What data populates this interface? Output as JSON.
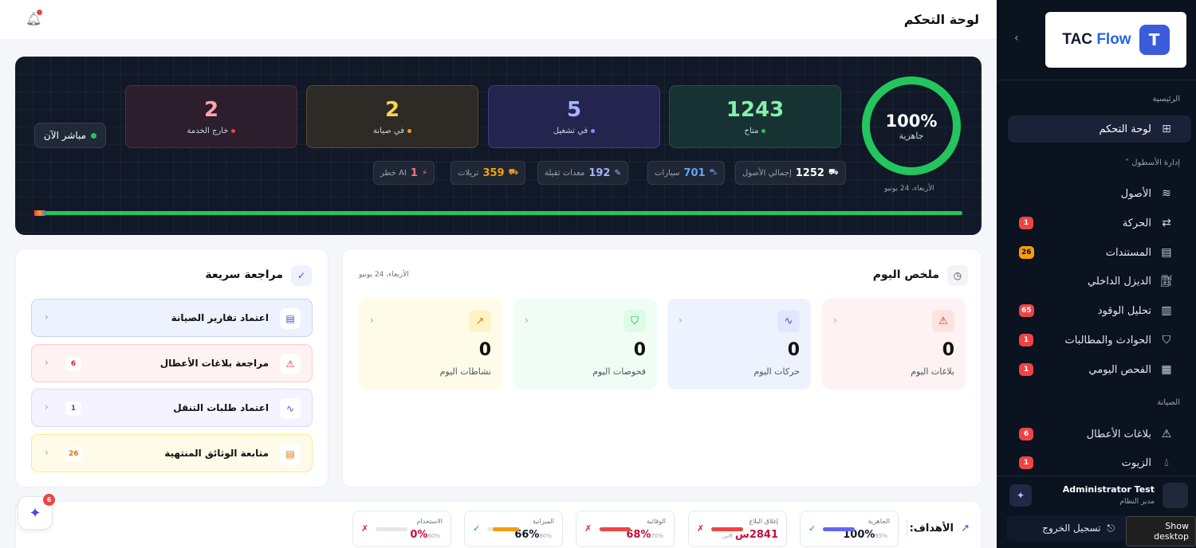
{
  "header": {
    "title": "لوحة التحكم"
  },
  "sidebar": {
    "logo": {
      "text1": "TAC ",
      "text2": "Flow",
      "mark": "T"
    },
    "sections": {
      "home": "الرئيسية",
      "fleet": "إدارة الأسطول",
      "maintenance": "الصيانة"
    },
    "items": [
      {
        "label": "لوحة التحكم",
        "icon": "grid-icon",
        "badge": ""
      },
      {
        "label": "الأصول",
        "icon": "layers-icon",
        "badge": ""
      },
      {
        "label": "الحركة",
        "icon": "transfer-icon",
        "badge": "1"
      },
      {
        "label": "المستندات",
        "icon": "document-icon",
        "badge": "26"
      },
      {
        "label": "الديزل الداخلي",
        "icon": "fuel-icon",
        "badge": ""
      },
      {
        "label": "تحليل الوقود",
        "icon": "chart-icon",
        "badge": "65"
      },
      {
        "label": "الحوادث والمطالبات",
        "icon": "shield-icon",
        "badge": "1"
      },
      {
        "label": "الفحص اليومي",
        "icon": "clipboard-icon",
        "badge": "1"
      },
      {
        "label": "بلاغات الأعطال",
        "icon": "warning-icon",
        "badge": "6"
      },
      {
        "label": "الزيوت",
        "icon": "drop-icon",
        "badge": "1"
      }
    ],
    "user": {
      "name": "Administrator Test",
      "role": "مدير النظام"
    },
    "logout": "تسجيل الخروج",
    "tooltip": "Show desktop"
  },
  "hero": {
    "readiness": {
      "value": "100%",
      "label": "جاهزية"
    },
    "date": "الأربعاء، 24 يونيو",
    "stats": [
      {
        "value": "1243",
        "label": "متاح",
        "color": "#22c55e"
      },
      {
        "value": "5",
        "label": "في تشغيل",
        "color": "#818cf8"
      },
      {
        "value": "2",
        "label": "في صيانة",
        "color": "#f59e0b"
      },
      {
        "value": "2",
        "label": "خارج الخدمة",
        "color": "#ef4444"
      }
    ],
    "live": "مباشر الآن",
    "chips": [
      {
        "value": "1252",
        "label": "إجمالي الأصول",
        "icon": "truck-icon",
        "color": "#ffffff"
      },
      {
        "value": "701",
        "label": "سيارات",
        "icon": "car-icon",
        "color": "#60a5fa"
      },
      {
        "value": "192",
        "label": "معدات ثقيلة",
        "icon": "wrench-icon",
        "color": "#a5b4fc"
      },
      {
        "value": "359",
        "label": "تريلات",
        "icon": "trailer-icon",
        "color": "#f59e0b"
      },
      {
        "value": "1",
        "label": "AI خطر",
        "icon": "bolt-icon",
        "color": "#fb7185"
      }
    ],
    "progress": 1.0
  },
  "today": {
    "title": "ملخص اليوم",
    "date": "الأربعاء، 24 يونيو",
    "tiles": [
      {
        "value": "0",
        "label": "بلاغات اليوم",
        "icon": "warning-icon"
      },
      {
        "value": "0",
        "label": "حركات اليوم",
        "icon": "activity-icon"
      },
      {
        "value": "0",
        "label": "فحوصات اليوم",
        "icon": "shield-icon"
      },
      {
        "value": "0",
        "label": "نشاطات اليوم",
        "icon": "trend-icon"
      }
    ]
  },
  "quick": {
    "title": "مراجعة سريعة",
    "items": [
      {
        "label": "اعتماد تقارير الصيانة",
        "badge": "",
        "icon": "document-icon"
      },
      {
        "label": "مراجعة بلاغات الأعطال",
        "badge": "6",
        "icon": "warning-icon"
      },
      {
        "label": "اعتماد طلبات التنقل",
        "badge": "1",
        "icon": "activity-icon"
      },
      {
        "label": "متابعة الوثائق المنتهية",
        "badge": "26",
        "icon": "file-icon"
      }
    ]
  },
  "goals": {
    "title": "الأهداف:",
    "items": [
      {
        "label": "الجاهزية",
        "value": "100%",
        "target": "85%",
        "mark": "✓",
        "fill": 1.0
      },
      {
        "label": "إغلاق البلاغ",
        "value": "2841س",
        "target": "8س",
        "mark": "✗",
        "fill": 1.0
      },
      {
        "label": "الوقائية",
        "value": "68%",
        "target": "70%",
        "mark": "✗",
        "fill": 0.97
      },
      {
        "label": "الميزانية",
        "value": "66%",
        "target": "80%",
        "mark": "✓",
        "fill": 0.82
      },
      {
        "label": "الاستخدام",
        "value": "0%",
        "target": "60%",
        "mark": "✗",
        "fill": 0.0
      }
    ]
  },
  "fab": {
    "badge": "6"
  }
}
